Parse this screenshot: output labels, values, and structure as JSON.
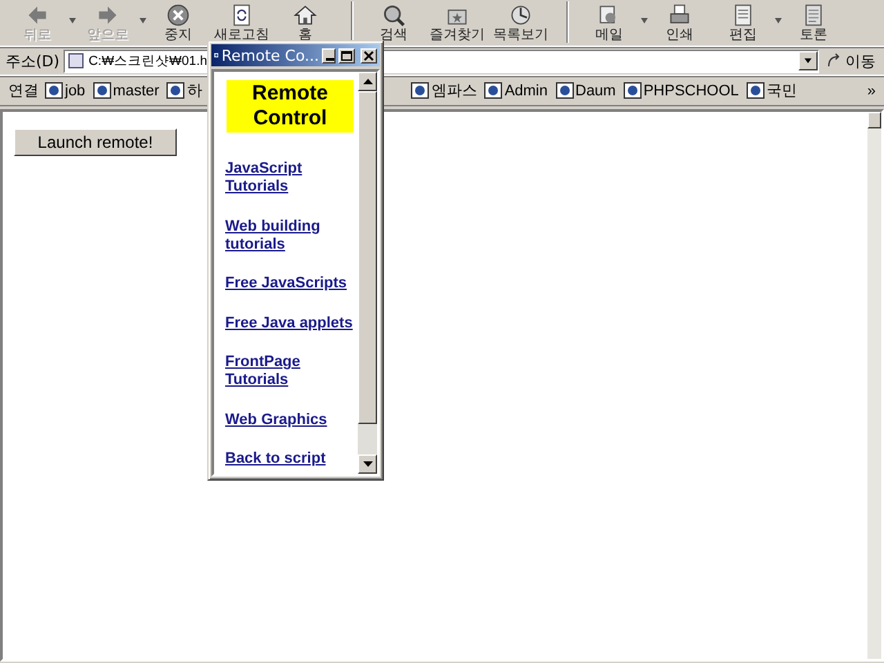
{
  "toolbar": [
    {
      "label": "뒤로",
      "disabled": true,
      "dropdown": true
    },
    {
      "label": "앞으로",
      "disabled": true,
      "dropdown": true
    },
    {
      "label": "중지",
      "disabled": false,
      "dropdown": false
    },
    {
      "label": "새로고침",
      "disabled": false,
      "dropdown": false
    },
    {
      "label": "홈",
      "disabled": false,
      "dropdown": false
    },
    {
      "label": "검색",
      "disabled": false,
      "dropdown": false
    },
    {
      "label": "즐겨찾기",
      "disabled": false,
      "dropdown": false
    },
    {
      "label": "목록보기",
      "disabled": false,
      "dropdown": false
    },
    {
      "label": "메일",
      "disabled": false,
      "dropdown": true
    },
    {
      "label": "인쇄",
      "disabled": false,
      "dropdown": false
    },
    {
      "label": "편집",
      "disabled": false,
      "dropdown": true
    },
    {
      "label": "토론",
      "disabled": false,
      "dropdown": false
    }
  ],
  "address": {
    "label": "주소(D)",
    "value": "C:₩스크린샷₩01.h",
    "go": "이동"
  },
  "links": {
    "label": "연결",
    "items": [
      "job",
      "master",
      "하",
      "엠파스",
      "Admin",
      "Daum",
      "PHPSCHOOL",
      "국민"
    ],
    "more": "»"
  },
  "page": {
    "launch_button": "Launch remote!"
  },
  "popup": {
    "title": "Remote Co...",
    "heading": "Remote Control",
    "links": [
      "JavaScript Tutorials",
      "Web building tutorials",
      "Free JavaScripts",
      "Free Java applets",
      "FrontPage Tutorials",
      "Web Graphics",
      "Back to script"
    ]
  }
}
